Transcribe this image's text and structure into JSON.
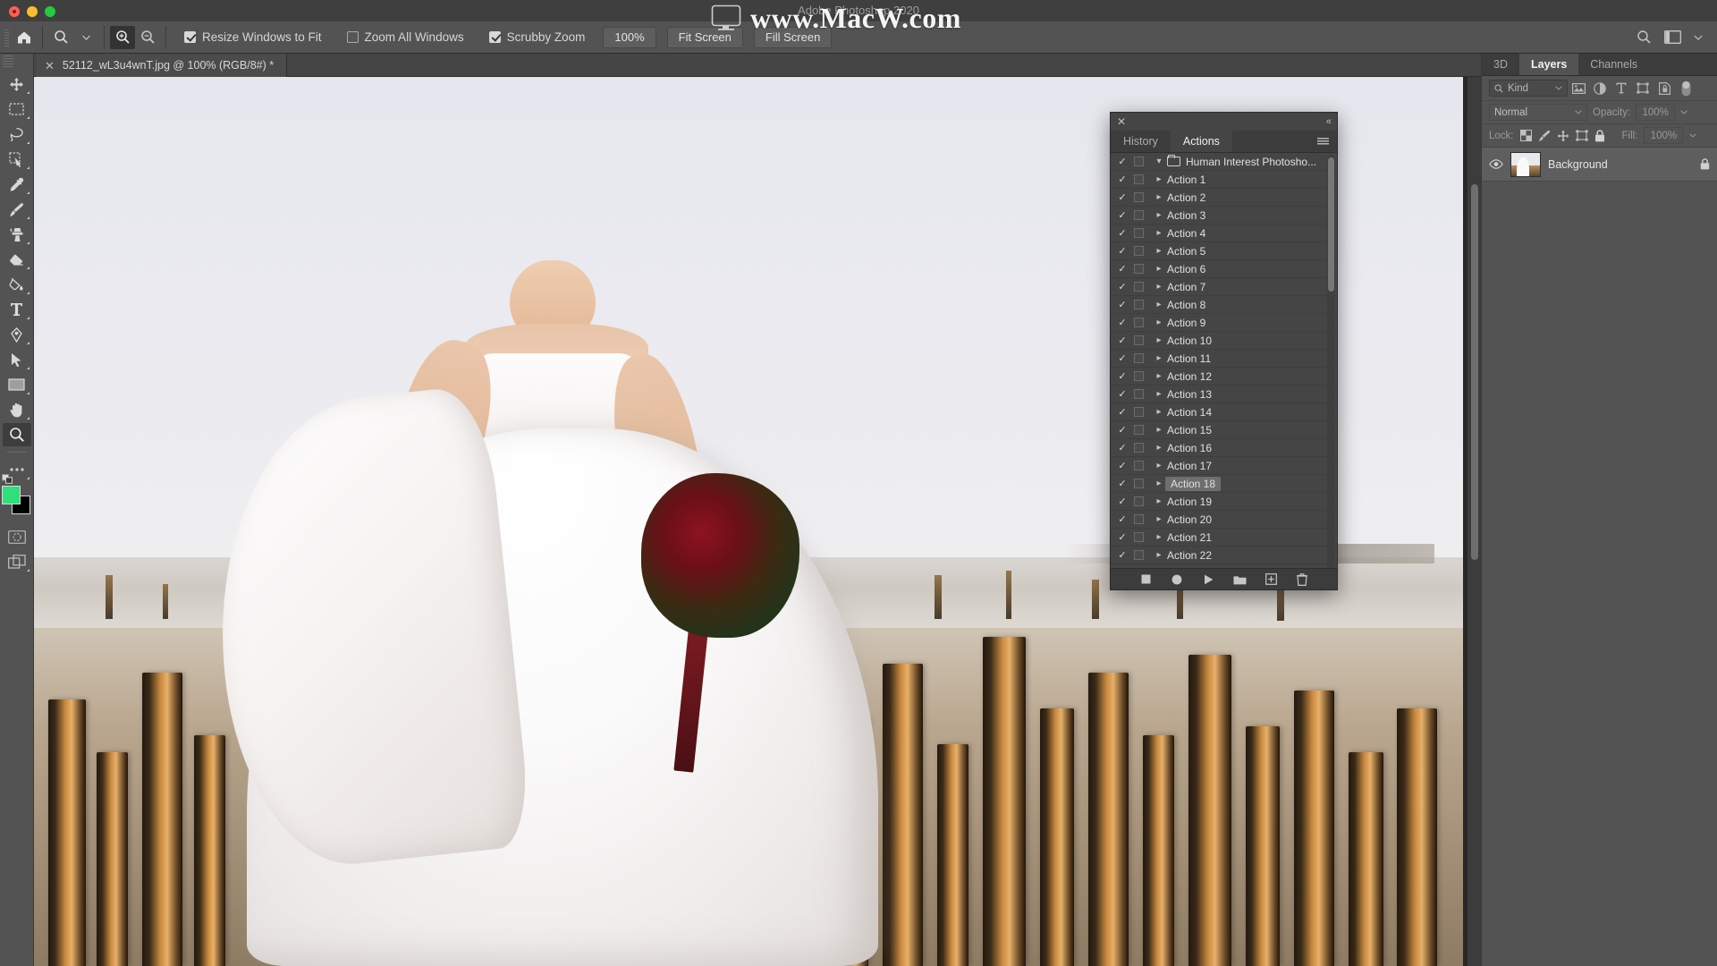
{
  "window": {
    "app_title": "Adobe Photoshop 2020",
    "traffic_lights": [
      "close-red",
      "minimize-yellow",
      "maximize-green"
    ]
  },
  "watermark": {
    "text": "www.MacW.com",
    "icon": "monitor-icon"
  },
  "options_bar": {
    "home_icon": "home-icon",
    "tool_preset_icon": "zoom-tool-icon",
    "tool_preset_chevron": "chevron-down-icon",
    "zoom_in_icon": "zoom-in-icon",
    "zoom_out_icon": "zoom-out-icon",
    "checkboxes": [
      {
        "label": "Resize Windows to Fit",
        "checked": true
      },
      {
        "label": "Zoom All Windows",
        "checked": false
      },
      {
        "label": "Scrubby Zoom",
        "checked": true
      }
    ],
    "buttons": [
      {
        "label": "100%"
      },
      {
        "label": "Fit Screen"
      },
      {
        "label": "Fill Screen"
      }
    ],
    "right_icons": [
      "search-icon",
      "workspace-icon",
      "chevron-down-icon"
    ]
  },
  "toolbar": {
    "tools": [
      {
        "name": "move-tool",
        "active": false
      },
      {
        "name": "rectangular-marquee-tool",
        "active": false
      },
      {
        "name": "lasso-tool",
        "active": false
      },
      {
        "name": "quick-selection-tool",
        "active": false
      },
      {
        "name": "eyedropper-tool",
        "active": false
      },
      {
        "name": "brush-tool",
        "active": false
      },
      {
        "name": "clone-stamp-tool",
        "active": false
      },
      {
        "name": "eraser-tool",
        "active": false
      },
      {
        "name": "paint-bucket-tool",
        "active": false
      },
      {
        "name": "type-tool",
        "active": false
      },
      {
        "name": "pen-tool",
        "active": false
      },
      {
        "name": "path-selection-tool",
        "active": false
      },
      {
        "name": "rectangle-tool",
        "active": false
      },
      {
        "name": "hand-tool",
        "active": false
      },
      {
        "name": "zoom-tool",
        "active": true
      },
      {
        "name": "more-tools-ellipsis",
        "active": false
      }
    ],
    "foreground_color": "#2fe07a",
    "background_color": "#000000",
    "quick-mask-icon": "quick-mask-icon",
    "screen-mode-icon": "screen-mode-icon"
  },
  "document": {
    "tab_title": "52112_wL3u4wnT.jpg @ 100% (RGB/8#) *",
    "close_icon": "close-icon"
  },
  "actions_panel": {
    "close_icon": "close-icon",
    "collapse_icon": "collapse-panel-icon",
    "menu_icon": "panel-menu-icon",
    "tabs": [
      {
        "label": "History",
        "active": false
      },
      {
        "label": "Actions",
        "active": true
      }
    ],
    "set_name": "Human Interest Photosho...",
    "rows": [
      {
        "label": "Action 1",
        "checked": true,
        "selected": false
      },
      {
        "label": "Action 2",
        "checked": true,
        "selected": false
      },
      {
        "label": "Action 3",
        "checked": true,
        "selected": false
      },
      {
        "label": "Action 4",
        "checked": true,
        "selected": false
      },
      {
        "label": "Action 5",
        "checked": true,
        "selected": false
      },
      {
        "label": "Action 6",
        "checked": true,
        "selected": false
      },
      {
        "label": "Action 7",
        "checked": true,
        "selected": false
      },
      {
        "label": "Action 8",
        "checked": true,
        "selected": false
      },
      {
        "label": "Action 9",
        "checked": true,
        "selected": false
      },
      {
        "label": "Action 10",
        "checked": true,
        "selected": false
      },
      {
        "label": "Action 11",
        "checked": true,
        "selected": false
      },
      {
        "label": "Action 12",
        "checked": true,
        "selected": false
      },
      {
        "label": "Action 13",
        "checked": true,
        "selected": false
      },
      {
        "label": "Action 14",
        "checked": true,
        "selected": false
      },
      {
        "label": "Action 15",
        "checked": true,
        "selected": false
      },
      {
        "label": "Action 16",
        "checked": true,
        "selected": false
      },
      {
        "label": "Action 17",
        "checked": true,
        "selected": false
      },
      {
        "label": "Action 18",
        "checked": true,
        "selected": true
      },
      {
        "label": "Action 19",
        "checked": true,
        "selected": false
      },
      {
        "label": "Action 20",
        "checked": true,
        "selected": false
      },
      {
        "label": "Action 21",
        "checked": true,
        "selected": false
      },
      {
        "label": "Action 22",
        "checked": true,
        "selected": false
      }
    ],
    "footer_buttons": [
      "stop-recording-icon",
      "begin-recording-icon",
      "play-selection-icon",
      "new-set-icon",
      "new-action-icon",
      "delete-icon"
    ]
  },
  "layers_panel": {
    "tabs": [
      {
        "label": "3D",
        "active": false
      },
      {
        "label": "Layers",
        "active": true
      },
      {
        "label": "Channels",
        "active": false
      }
    ],
    "filter": {
      "kind_label": "Kind",
      "search_icon": "search-icon",
      "chevron_icon": "chevron-down-icon",
      "type_icons": [
        "filter-pixel-icon",
        "filter-adjustment-icon",
        "filter-type-icon",
        "filter-shape-icon",
        "filter-smart-object-icon",
        "filter-toggle-icon"
      ]
    },
    "blend_mode": "Normal",
    "opacity_label": "Opacity:",
    "opacity_value": "100%",
    "lock_label": "Lock:",
    "lock_icons": [
      "lock-transparent-pixels-icon",
      "lock-image-pixels-icon",
      "lock-position-icon",
      "lock-artboard-nesting-icon",
      "lock-all-icon"
    ],
    "fill_label": "Fill:",
    "fill_value": "100%",
    "layers": [
      {
        "name": "Background",
        "visible": true,
        "locked": true,
        "visibility_icon": "eye-icon",
        "lock_icon": "lock-icon",
        "thumbnail": "layer-thumbnail"
      }
    ]
  }
}
